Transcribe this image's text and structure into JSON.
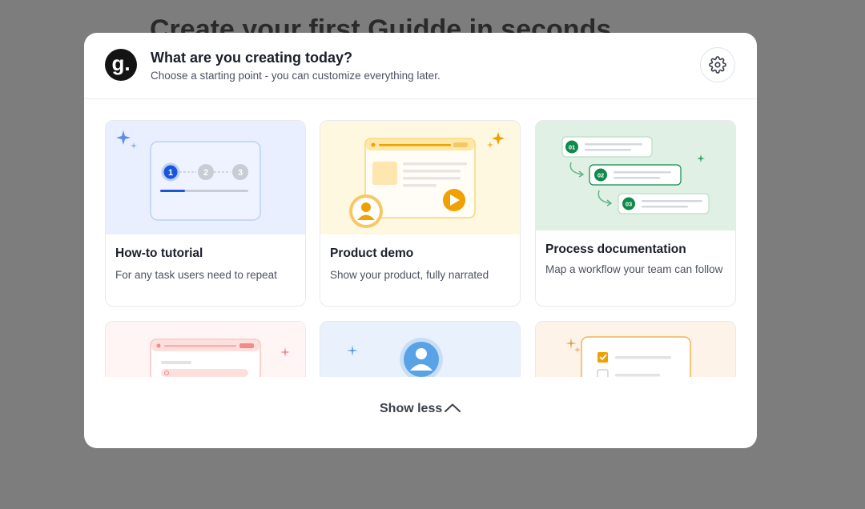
{
  "background": {
    "title": "Create your first Guidde in seconds"
  },
  "modal": {
    "logo_letter": "g.",
    "title": "What are you creating today?",
    "subtitle": "Choose a starting point - you can customize everything later.",
    "settings_icon": "gear-icon"
  },
  "cards": [
    {
      "title": "How-to tutorial",
      "description": "For any task users need to repeat",
      "steps": [
        "1",
        "2",
        "3"
      ]
    },
    {
      "title": "Product demo",
      "description": "Show your product, fully narrated"
    },
    {
      "title": "Process documentation",
      "description": "Map a workflow your team can follow",
      "steps": [
        "01",
        "02",
        "03"
      ]
    },
    {
      "title": "",
      "description": ""
    },
    {
      "title": "",
      "description": ""
    },
    {
      "title": "",
      "description": ""
    }
  ],
  "footer": {
    "show_less_label": "Show less",
    "chevron_icon": "chevron-up-icon"
  },
  "colors": {
    "overlay": "#7d7d7d",
    "blue_accent": "#1a56db",
    "green_accent": "#0f8a4a",
    "orange_accent": "#f0a000"
  }
}
